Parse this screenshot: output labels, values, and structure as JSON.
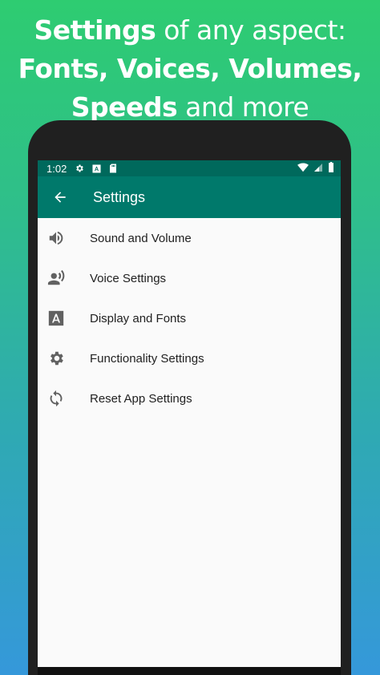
{
  "headline": {
    "line1_bold": "Settings",
    "line1_rest": " of any aspect:",
    "line2": "Fonts, Voices, Volumes,",
    "line3_bold": "Speeds",
    "line3_rest": " and more"
  },
  "statusbar": {
    "time": "1:02",
    "icons": [
      "gear-icon",
      "font-icon",
      "sd-card-icon"
    ],
    "right_icons": [
      "wifi-icon",
      "signal-icon",
      "battery-icon"
    ]
  },
  "appbar": {
    "title": "Settings",
    "back_icon": "arrow-back-icon"
  },
  "menu": {
    "items": [
      {
        "label": "Sound and Volume",
        "icon": "volume-icon"
      },
      {
        "label": "Voice Settings",
        "icon": "voice-icon"
      },
      {
        "label": "Display and Fonts",
        "icon": "font-icon"
      },
      {
        "label": "Functionality Settings",
        "icon": "gear-icon"
      },
      {
        "label": "Reset App Settings",
        "icon": "sync-icon"
      }
    ]
  },
  "colors": {
    "statusbar": "#00695c",
    "appbar": "#00796b",
    "icon": "#616161",
    "text": "#212121",
    "screen_bg": "#fafafa"
  }
}
